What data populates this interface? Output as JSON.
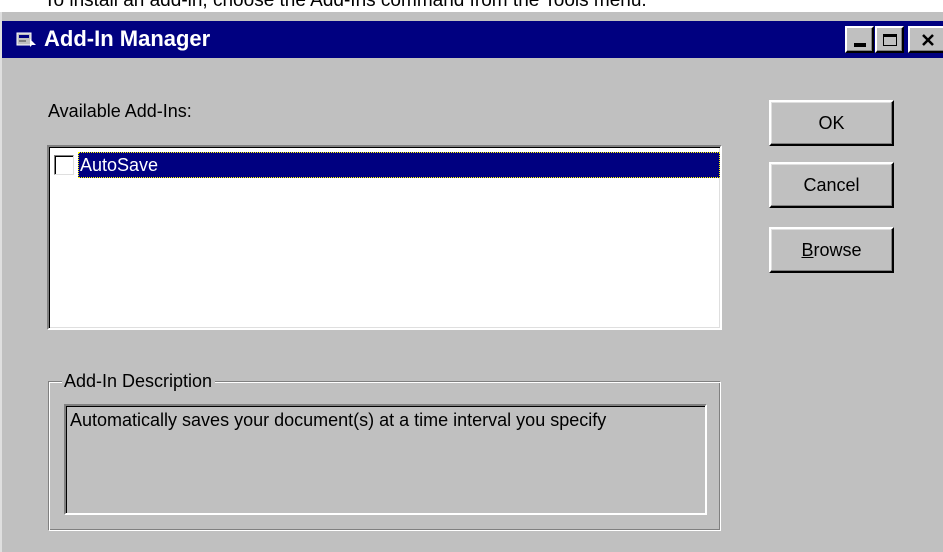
{
  "caption": "To install an add-in, choose the Add-Ins command from the Tools menu.",
  "window": {
    "title": "Add-In Manager",
    "icon": "add-in-manager-icon",
    "controls": {
      "minimize": "minimize-icon",
      "maximize": "maximize-icon",
      "close": "close-icon"
    }
  },
  "available": {
    "label": "Available Add-Ins:",
    "items": [
      {
        "label": "AutoSave",
        "checked": false,
        "selected": true
      }
    ]
  },
  "description": {
    "group_title": "Add-In Description",
    "text": "Automatically saves your document(s) at a time interval you specify"
  },
  "buttons": {
    "ok": "OK",
    "cancel": "Cancel",
    "browse_first": "B",
    "browse_rest": "rowse"
  },
  "colors": {
    "titlebar": "#000080",
    "face": "#c0c0c0",
    "selection": "#000080"
  }
}
